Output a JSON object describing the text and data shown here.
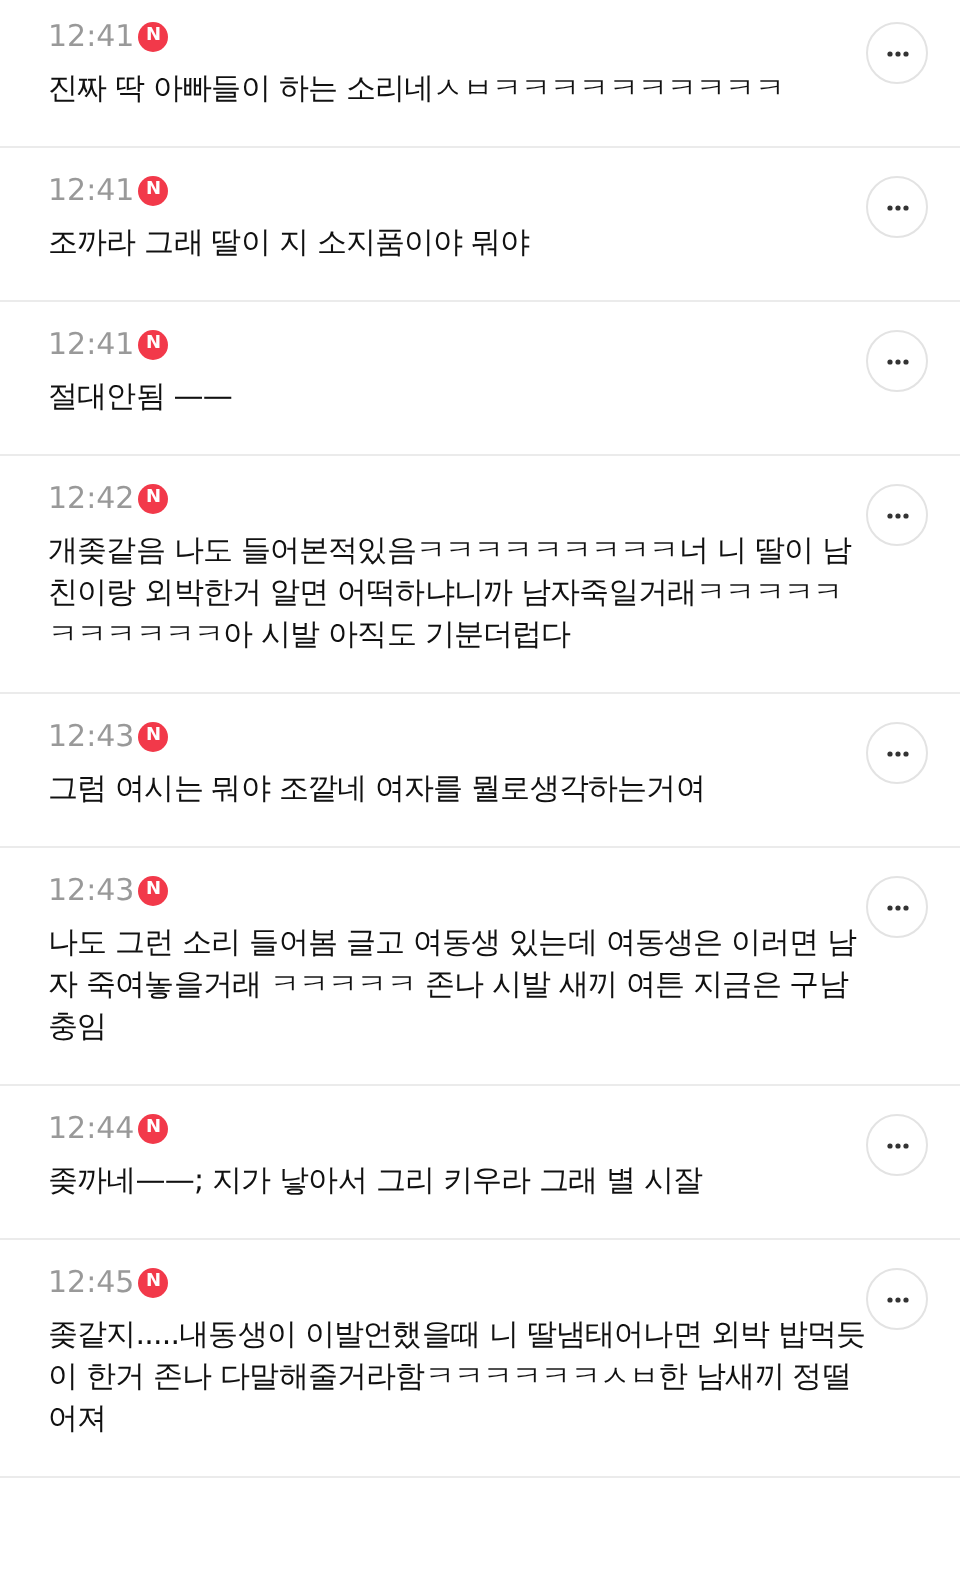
{
  "comments": [
    {
      "time": "12:41",
      "badge": "N",
      "text": "진짜 딱 아빠들이 하는 소리네ㅅㅂㅋㅋㅋㅋㅋㅋㅋㅋㅋㅋ"
    },
    {
      "time": "12:41",
      "badge": "N",
      "text": "조까라 그래 딸이 지 소지품이야 뭐야"
    },
    {
      "time": "12:41",
      "badge": "N",
      "text": "절대안됨 ——"
    },
    {
      "time": "12:42",
      "badge": "N",
      "text": "개좆같음 나도 들어본적있음ㅋㅋㅋㅋㅋㅋㅋㅋㅋ너 니 딸이 남친이랑 외박한거 알면 어떡하냐니까 남자죽일거래ㅋㅋㅋㅋㅋㅋㅋㅋㅋㅋㅋ아 시발 아직도 기분더럽다"
    },
    {
      "time": "12:43",
      "badge": "N",
      "text": "그럼 여시는 뭐야 조깥네 여자를 뭘로생각하는거여"
    },
    {
      "time": "12:43",
      "badge": "N",
      "text": "나도 그런 소리 들어봄 글고 여동생 있는데 여동생은 이러면 남자 죽여놓을거래 ㅋㅋㅋㅋㅋ 존나 시발 새끼 여튼 지금은 구남충임"
    },
    {
      "time": "12:44",
      "badge": "N",
      "text": "좆까네——; 지가 낳아서 그리 키우라 그래 별 시잘"
    },
    {
      "time": "12:45",
      "badge": "N",
      "text": "좆같지.....내동생이 이발언했을때 니 딸냄태어나면 외박 밥먹듯이 한거 존나 다말해줄거라함ㅋㅋㅋㅋㅋㅋㅅㅂ한 남새끼 정떨어져"
    }
  ]
}
